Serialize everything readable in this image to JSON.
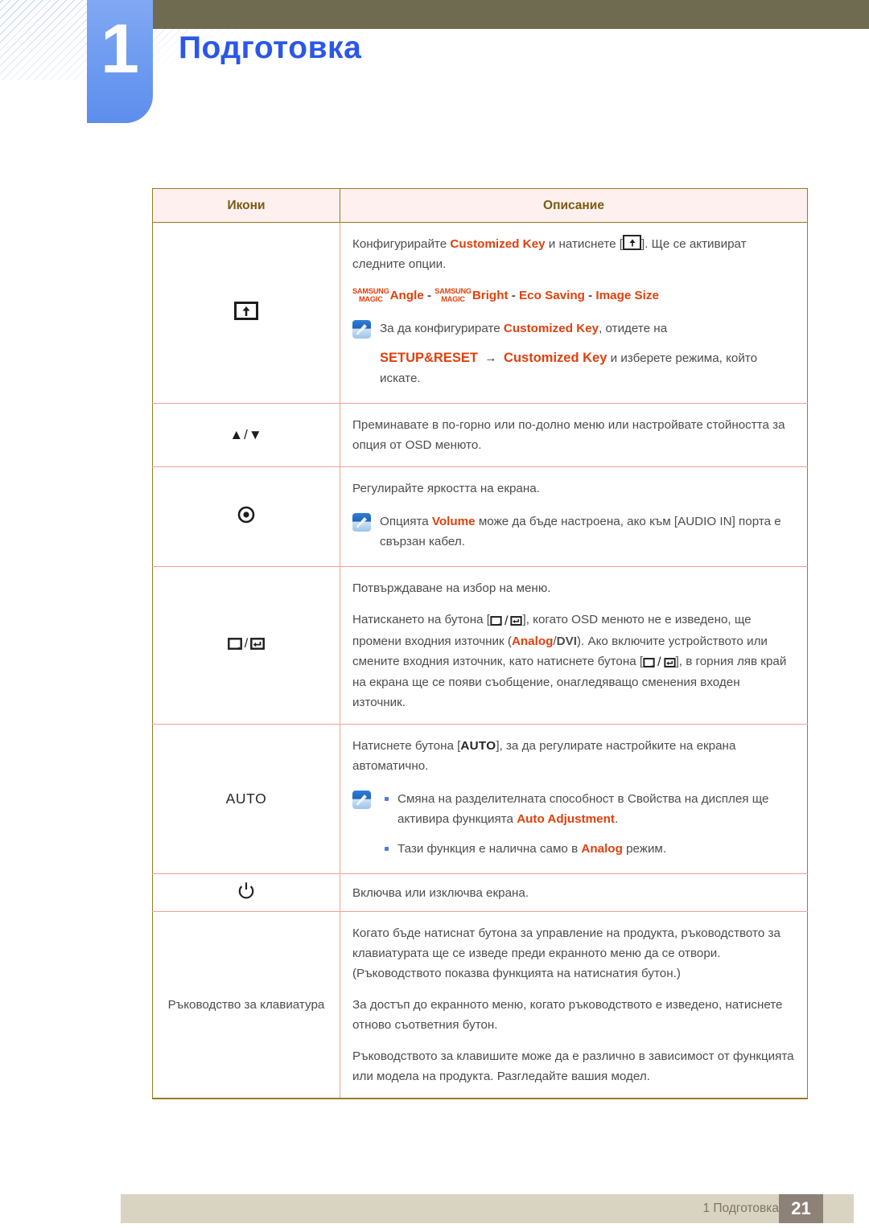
{
  "header": {
    "chapter_number": "1",
    "title": "Подготовка",
    "accent_blue": "#2b57e8",
    "tab_blue": "#6d9af0",
    "bar_olive": "#6e6b51"
  },
  "table": {
    "columns": [
      "Икони",
      "Описание"
    ],
    "rows": [
      {
        "icon_name": "customized-key-icon",
        "icon_label": "",
        "paragraphs": [
          "Конфигурирайте Customized Key и натиснете [ ]. Ще се активират следните опции."
        ],
        "magic_line": {
          "prefix_small_1": "SAMSUNG",
          "prefix_small_2": "MAGIC",
          "item1": "Angle",
          "item2": "Bright",
          "item3": "Eco Saving",
          "item4": "Image Size",
          "separator": " - "
        },
        "note": {
          "line1_a": "За да конфигурирате ",
          "line1_key": "Customized Key",
          "line1_b": ", отидете на",
          "line2_a": "SETUP&RESET",
          "line2_arrow": "→",
          "line2_b": "Customized Key",
          "line2_c": " и изберете режима, който искате."
        }
      },
      {
        "icon_name": "up-down-arrows-icon",
        "icon_label": "▲/▼",
        "paragraphs": [
          "Преминавате в по-горно или по-долно меню или настройвате стойността за опция от OSD менюто."
        ]
      },
      {
        "icon_name": "brightness-volume-icon",
        "icon_label": "",
        "paragraphs": [
          "Регулирайте яркостта на екрана."
        ],
        "note": {
          "line1_a": "Опцията ",
          "line1_key": "Volume",
          "line1_b": " може да бъде настроена, ако към [AUDIO IN] порта е свързан кабел."
        }
      },
      {
        "icon_name": "menu-enter-icon",
        "icon_label": "",
        "paragraphs": [
          "Потвърждаване на избор на меню.",
          "Натискането на бутона [ / ], когато OSD менюто не е изведено, ще промени входния източник (Analog/DVI). Ако включите устройството или смените входния източник, като натиснете бутона [ / ], в горния ляв край на екрана ще се появи съобщение, онагледяващо сменения входен източник."
        ]
      },
      {
        "icon_name": "auto-button-icon",
        "icon_label": "AUTO",
        "paragraphs": [
          "Натиснете бутона [AUTO], за да регулирате настройките на екрана автоматично."
        ],
        "note_bullets": [
          {
            "text_a": "Смяна на разделителната способност в Свойства на дисплея ще активира функцията ",
            "key": "Auto Adjustment",
            "text_b": "."
          },
          {
            "text_a": "Тази функция е налична само в ",
            "key": "Analog",
            "text_b": " режим."
          }
        ]
      },
      {
        "icon_name": "power-icon",
        "icon_label": "",
        "paragraphs": [
          "Включва или изключва екрана."
        ]
      },
      {
        "icon_name": "keyboard-guide-label",
        "icon_label": "Ръководство за клавиатура",
        "paragraphs": [
          "Когато бъде натиснат бутона за управление на продукта, ръководството за клавиатурата ще се изведе преди екранното меню да се отвори. (Ръководството показва функцията на натиснатия бутон.)",
          "За достъп до екранното меню, когато ръководството е изведено, натиснете отново съответния бутон.",
          "Ръководството за клавишите може да е различно в зависимост от функцията или модела на продукта. Разгледайте вашия модел."
        ]
      }
    ]
  },
  "inline": {
    "customized_key": "Customized Key",
    "setup_reset": "SETUP&RESET",
    "arrow": "→",
    "analog": "Analog",
    "dvi": "DVI",
    "slash": "/",
    "auto": "AUTO",
    "volume": "Volume",
    "auto_adjustment": "Auto Adjustment",
    "osd": "OSD",
    "audio_in": "[AUDIO IN]"
  },
  "footer": {
    "text": "1 Подготовка",
    "page_number": "21",
    "bar_color": "#d9d3c2",
    "page_box_color": "#8e8178"
  }
}
